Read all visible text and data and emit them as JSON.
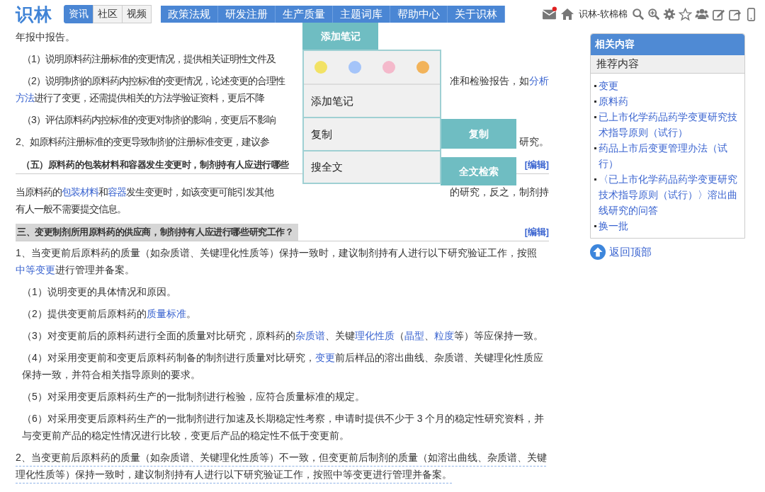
{
  "header": {
    "logo": "识林",
    "tabs": [
      {
        "label": "资讯",
        "selected": true
      },
      {
        "label": "社区",
        "selected": false
      },
      {
        "label": "视频",
        "selected": false
      }
    ],
    "nav": [
      "政策法规",
      "研发注册",
      "生产质量",
      "主题词库",
      "帮助中心",
      "关于识林"
    ],
    "mail_unread": true,
    "user": "识林-软棉棉"
  },
  "article": [
    {
      "kind": "para",
      "indented": false,
      "segments": [
        {
          "text": "年报中报告。"
        }
      ]
    },
    {
      "kind": "lines",
      "indented": true,
      "lines": [
        {
          "left": [
            {
              "text": "（1）说明原料药注册标准的变更情况，提供相关证明性文件及"
            }
          ]
        }
      ]
    },
    {
      "kind": "lines",
      "indented": true,
      "lines": [
        {
          "left": [
            {
              "text": "（2）说明制剂的原料药内控标准的变更情况，论述变更的合理性"
            }
          ],
          "right": [
            {
              "text": "准和检验报告，如"
            },
            {
              "text": "分析",
              "link": true
            }
          ]
        },
        {
          "left": [
            {
              "text": "方法",
              "link": true
            },
            {
              "text": "进行了变更，还需提供相关的方法学验证资料，更后不降"
            }
          ]
        }
      ]
    },
    {
      "kind": "lines",
      "indented": true,
      "lines": [
        {
          "left": [
            {
              "text": "（3）评估原料药内控标准的变更对制剂的影响，变更后不影响"
            }
          ]
        }
      ]
    },
    {
      "kind": "lines",
      "indented": false,
      "lines": [
        {
          "left": [
            {
              "text": "2、如原料药注册标准的变更导致制剂的注册标准变更，建议参"
            }
          ],
          "right": [
            {
              "text": "研究。"
            }
          ]
        }
      ]
    },
    {
      "kind": "heading",
      "highlight": false,
      "text": "（五）原料药的包装材料和容器发生变更时，制剂持有人应进行哪些",
      "edit": "[编辑]"
    },
    {
      "kind": "lines",
      "indented": false,
      "lines": [
        {
          "left": [
            {
              "text": "当原料药的"
            },
            {
              "text": "包装材料",
              "link": true
            },
            {
              "text": "和"
            },
            {
              "text": "容器",
              "link": true
            },
            {
              "text": "发生变更时，如该变更可能引发其他"
            }
          ],
          "right": [
            {
              "text": "的研究，反之，制剂持"
            }
          ]
        },
        {
          "left": [
            {
              "text": "有人一般不需要提交信息。"
            }
          ]
        }
      ]
    },
    {
      "kind": "heading",
      "highlight": true,
      "text": "三、变更制剂所用原料药的供应商，制剂持有人应进行哪些研究工作？",
      "edit": "[编辑]"
    },
    {
      "kind": "para",
      "indented": false,
      "segments": [
        {
          "text": "1、当变更前后原料药的质量（如杂质谱、关键理化性质等）保持一致时，建议制剂持有人进行以下研究验证工作，按照"
        },
        {
          "text": "中等变更",
          "link": true
        },
        {
          "text": "进行管理并备案。"
        }
      ]
    },
    {
      "kind": "para",
      "indented": true,
      "segments": [
        {
          "text": "（1）说明变更的具体情况和原因。"
        }
      ]
    },
    {
      "kind": "para",
      "indented": true,
      "segments": [
        {
          "text": "（2）提供变更前后原料药的"
        },
        {
          "text": "质量标准",
          "link": true
        },
        {
          "text": "。"
        }
      ]
    },
    {
      "kind": "para",
      "indented": true,
      "segments": [
        {
          "text": "（3）对变更前后的原料药进行全面的质量对比研究，原料药的"
        },
        {
          "text": "杂质谱",
          "link": true
        },
        {
          "text": "、关键"
        },
        {
          "text": "理化性质",
          "link": true
        },
        {
          "text": "（"
        },
        {
          "text": "晶型",
          "link": true
        },
        {
          "text": "、"
        },
        {
          "text": "粒度",
          "link": true
        },
        {
          "text": "等）等应保持一致。"
        }
      ]
    },
    {
      "kind": "para",
      "indented": true,
      "segments": [
        {
          "text": "（4）对采用变更前和变更后原料药制备的制剂进行质量对比研究，"
        },
        {
          "text": "变更",
          "link": true
        },
        {
          "text": "前后样品的溶出曲线、杂质谱、关键理化性质应保持一致，并符合相关指导原则的要求。"
        }
      ]
    },
    {
      "kind": "para",
      "indented": true,
      "segments": [
        {
          "text": "（5）对采用变更后原料药生产的一批制剂进行检验，应符合质量标准的规定。"
        }
      ]
    },
    {
      "kind": "para",
      "indented": true,
      "segments": [
        {
          "text": "（6）对采用变更后原料药生产的一批制剂进行加速及长期稳定性考察，申请时提供不少于 3 个月的稳定性研究资料，并与变更前产品的稳定性情况进行比较，变更后产品的稳定性不低于变更前。"
        }
      ]
    },
    {
      "kind": "para",
      "indented": false,
      "dotted": true,
      "segments": [
        {
          "text": "2、当变更前后原料药的质量（如杂质谱、关键理化性质等）不一致，但变更前后制剂的质量（如溶出曲线、杂质谱、关键理化性质等）保持一致时，建议制剂持有人进行以下研究验证工作，按照中等变更进行管理并备案。"
        }
      ]
    }
  ],
  "popup": {
    "title": "添加笔记",
    "colors": [
      {
        "color": "#f2e265"
      },
      {
        "color": "#a4c4f9"
      },
      {
        "color": "#f4b9cb"
      },
      {
        "color": "#f2b35a"
      }
    ],
    "items": [
      {
        "label": "添加笔记"
      },
      {
        "label": "复制",
        "action": "复制"
      },
      {
        "label": "搜全文",
        "action": "全文检索"
      }
    ]
  },
  "sidebar": {
    "title": "相关内容",
    "subtitle": "推荐内容",
    "links": [
      "变更",
      "原料药",
      "已上市化学药品药学变更研究技术指导原则（试行）",
      "药品上市后变更管理办法（试行）",
      "〈已上市化学药品药学变更研究技术指导原则（试行）〉溶出曲线研究的问答",
      "换一批"
    ],
    "back_to_top": "返回顶部"
  }
}
